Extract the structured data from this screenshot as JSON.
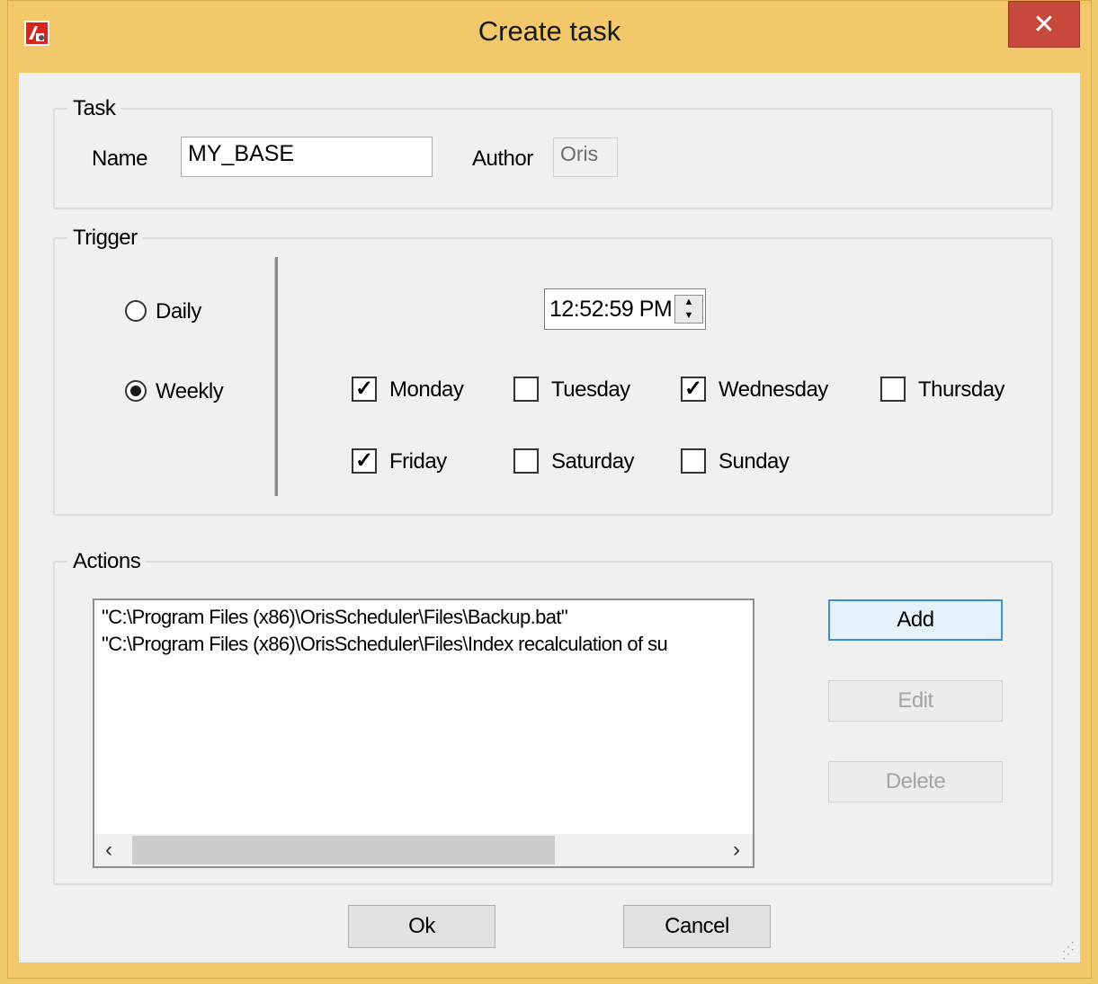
{
  "window": {
    "title": "Create task",
    "close_glyph": "✕",
    "icon": "app-scheduler-icon"
  },
  "task": {
    "group_label": "Task",
    "name_label": "Name",
    "name_value": "MY_BASE",
    "author_label": "Author",
    "author_value": "Oris"
  },
  "trigger": {
    "group_label": "Trigger",
    "daily_label": "Daily",
    "weekly_label": "Weekly",
    "selected": "Weekly",
    "time_value": "12:52:59 PM",
    "days": [
      {
        "label": "Monday",
        "checked": true
      },
      {
        "label": "Tuesday",
        "checked": false
      },
      {
        "label": "Wednesday",
        "checked": true
      },
      {
        "label": "Thursday",
        "checked": false
      },
      {
        "label": "Friday",
        "checked": true
      },
      {
        "label": "Saturday",
        "checked": false
      },
      {
        "label": "Sunday",
        "checked": false
      }
    ]
  },
  "actions": {
    "group_label": "Actions",
    "items": [
      "\"C:\\Program Files (x86)\\OrisScheduler\\Files\\Backup.bat\"",
      "\"C:\\Program Files (x86)\\OrisScheduler\\Files\\Index recalculation of su"
    ],
    "add_label": "Add",
    "edit_label": "Edit",
    "delete_label": "Delete"
  },
  "footer": {
    "ok_label": "Ok",
    "cancel_label": "Cancel"
  },
  "colors": {
    "frame": "#f2c86a",
    "close_button": "#c7483c",
    "client": "#f0f0f0",
    "focus_border": "#3c8ed8"
  }
}
